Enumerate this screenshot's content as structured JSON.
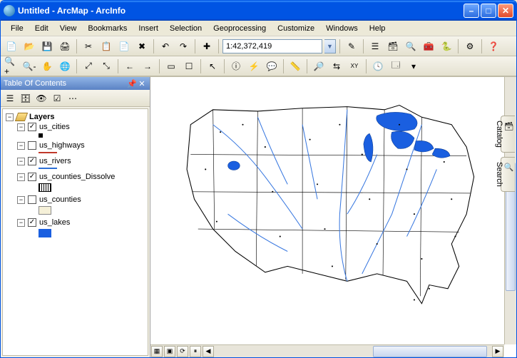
{
  "window": {
    "title": "Untitled - ArcMap - ArcInfo"
  },
  "menu": {
    "file": "File",
    "edit": "Edit",
    "view": "View",
    "bookmarks": "Bookmarks",
    "insert": "Insert",
    "selection": "Selection",
    "geoprocessing": "Geoprocessing",
    "customize": "Customize",
    "windows": "Windows",
    "help": "Help"
  },
  "toolbar": {
    "scale": "1:42,372,419"
  },
  "toc": {
    "title": "Table Of Contents",
    "root": "Layers",
    "layers": [
      {
        "name": "us_cities",
        "checked": true,
        "sym": "dot"
      },
      {
        "name": "us_highways",
        "checked": false,
        "sym": "line-red"
      },
      {
        "name": "us_rivers",
        "checked": true,
        "sym": "line-blue"
      },
      {
        "name": "us_counties_Dissolve",
        "checked": true,
        "sym": "box-hatch"
      },
      {
        "name": "us_counties",
        "checked": false,
        "sym": "box-tan"
      },
      {
        "name": "us_lakes",
        "checked": true,
        "sym": "box-blue"
      }
    ]
  },
  "dock": {
    "catalog": "Catalog",
    "search": "Search"
  },
  "map": {
    "region": "Contiguous United States",
    "visible_layers": [
      "us_cities",
      "us_rivers",
      "us_counties_Dissolve",
      "us_lakes"
    ],
    "lakes_highlighted": [
      "Great Lakes",
      "Great Salt Lake"
    ]
  }
}
